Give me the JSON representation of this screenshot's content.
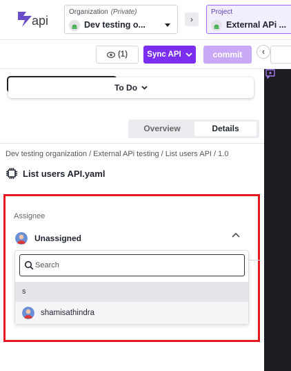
{
  "header": {
    "logo_text": "api",
    "organization": {
      "caption": "Organization",
      "visibility": "(Private)",
      "value": "Dev testing o..."
    },
    "project": {
      "caption": "Project",
      "value": "External APi ..."
    }
  },
  "toolbar": {
    "watch_count": "(1)",
    "sync_label": "Sync API",
    "commit_label": "commit"
  },
  "status": {
    "label": "To Do"
  },
  "tabs": [
    {
      "label": "Overview",
      "active": false
    },
    {
      "label": "Details",
      "active": true
    }
  ],
  "breadcrumb": "Dev testing organization / External APi testing / List users API / 1.0",
  "file": {
    "title": "List users API.yaml"
  },
  "assignee": {
    "label": "Assignee",
    "value": "Unassigned",
    "search_placeholder": "Search",
    "group_label": "s",
    "options": [
      {
        "name": "shamisathindra"
      }
    ]
  },
  "colors": {
    "accent": "#7b2ef0",
    "accent_disabled": "#c9a9f7",
    "highlight": "#e5191d",
    "dark_panel": "#1c1c21"
  }
}
